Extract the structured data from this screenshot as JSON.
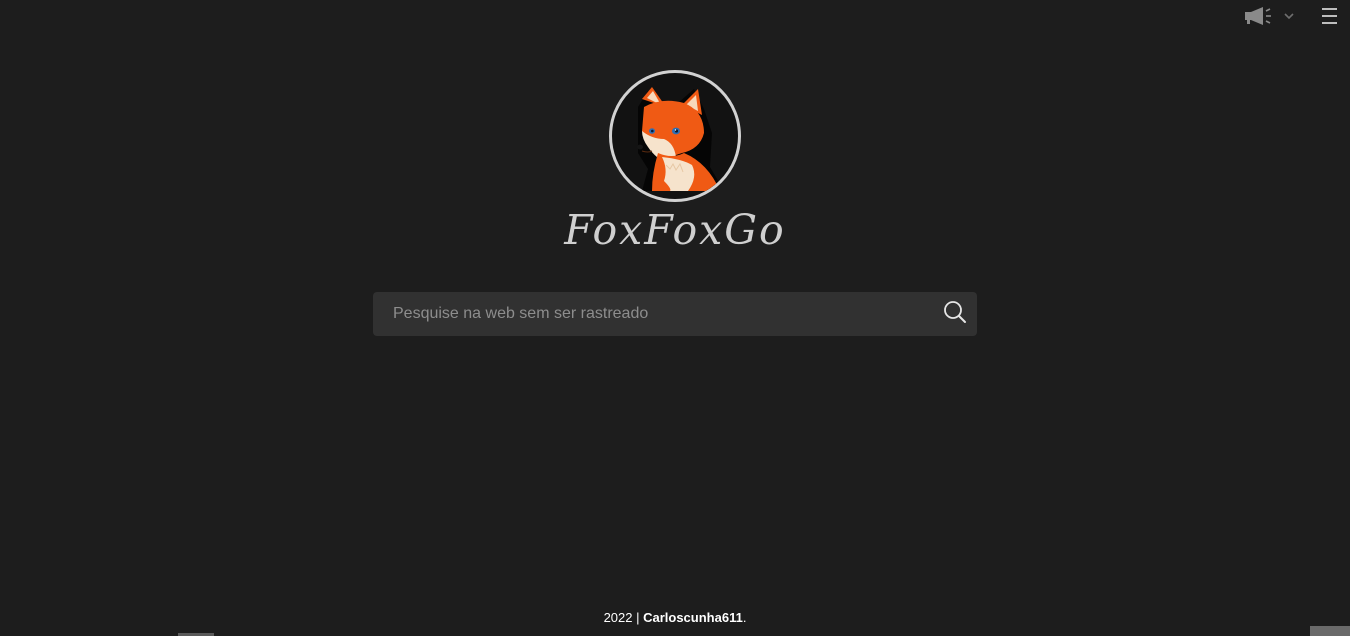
{
  "header": {
    "announce_icon": "megaphone-icon",
    "dropdown_icon": "chevron-down-icon",
    "menu_icon": "hamburger-menu-icon"
  },
  "logo": {
    "image": "fox-logo",
    "brand_name": "FoxFoxGo"
  },
  "search": {
    "placeholder": "Pesquise na web sem ser rastreado",
    "value": "",
    "button_icon": "search-icon"
  },
  "footer": {
    "year": "2022",
    "separator": " | ",
    "author": "Carloscunha611",
    "suffix": "."
  },
  "colors": {
    "background": "#1d1d1d",
    "search_background": "#313131",
    "fox_orange": "#f05a14",
    "logo_ring": "#d2d2d2"
  }
}
